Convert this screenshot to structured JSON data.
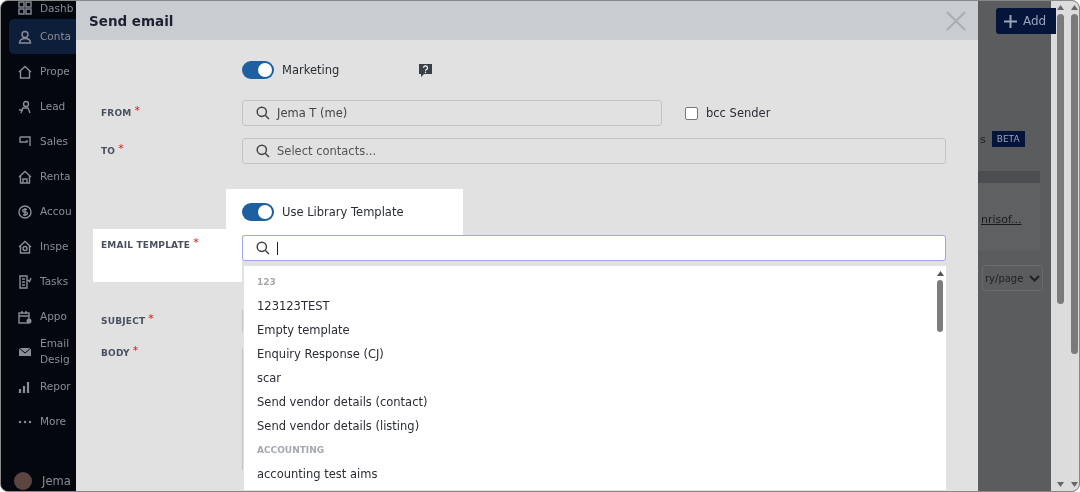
{
  "sidebar": {
    "items": [
      {
        "label": "Dashb",
        "selected": false
      },
      {
        "label": "Conta",
        "selected": true
      },
      {
        "label": "Prope",
        "selected": false
      },
      {
        "label": "Lead",
        "selected": false
      },
      {
        "label": "Sales",
        "selected": false
      },
      {
        "label": "Renta",
        "selected": false
      },
      {
        "label": "Accou",
        "selected": false
      },
      {
        "label": "Inspe",
        "selected": false
      },
      {
        "label": "Tasks",
        "selected": false
      },
      {
        "label": "Appo",
        "selected": false
      },
      {
        "label": "Email Desig",
        "selected": false
      },
      {
        "label": "Repor",
        "selected": false
      },
      {
        "label": "More",
        "selected": false
      }
    ],
    "user": {
      "name": "Jema"
    }
  },
  "background_page": {
    "add_button": "Add",
    "section_title": "s",
    "badge": "BETA",
    "link": "nrisof...",
    "page_size": "ry/page"
  },
  "modal": {
    "title": "Send email",
    "marketing_toggle": {
      "label": "Marketing",
      "on": true
    },
    "from": {
      "label": "FROM",
      "required_mark": "*",
      "value": "Jema T (me)"
    },
    "bcc_sender": {
      "label": "bcc Sender",
      "checked": false
    },
    "to": {
      "label": "TO",
      "required_mark": "*",
      "placeholder": "Select contacts..."
    },
    "library_toggle": {
      "label": "Use Library Template",
      "on": true
    },
    "email_template": {
      "label": "EMAIL TEMPLATE",
      "required_mark": "*"
    },
    "subject": {
      "label": "SUBJECT",
      "required_mark": "*"
    },
    "body": {
      "label": "BODY",
      "required_mark": "*"
    },
    "template_dropdown": {
      "groups": [
        {
          "name": "123",
          "items": [
            "123123TEST",
            "Empty template",
            "Enquiry Response (CJ)",
            "scar",
            "Send vendor details (contact)",
            "Send vendor details (listing)"
          ]
        },
        {
          "name": "ACCOUNTING",
          "items": [
            "accounting test aims"
          ]
        }
      ]
    }
  }
}
